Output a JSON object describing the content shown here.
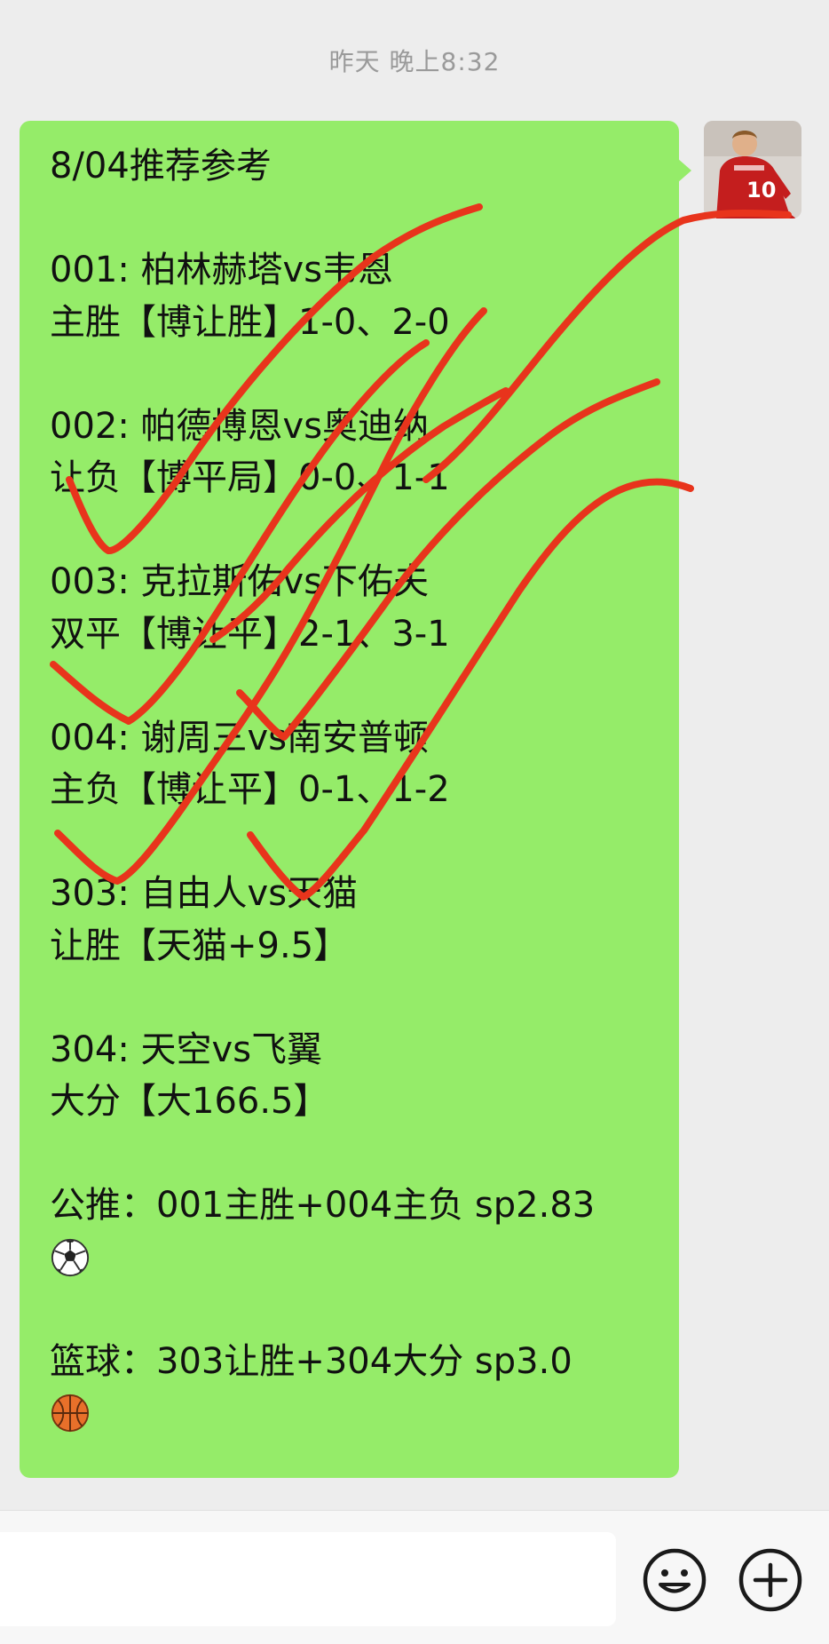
{
  "chat": {
    "timestamp": "昨天 晚上8:32"
  },
  "message": {
    "lines": [
      "8/04推荐参考",
      "",
      "001: 柏林赫塔vs韦恩",
      "主胜【博让胜】1-0、2-0",
      "",
      "002: 帕德博恩vs奥迪纳",
      "让负【博平局】0-0、1-1",
      "",
      "003: 克拉斯佑vs下佑夫",
      "双平【博让平】2-1、3-1",
      "",
      "004: 谢周三vs南安普顿",
      "主负【博让平】0-1、1-2",
      "",
      "303: 自由人vs天猫",
      "让胜【天猫+9.5】",
      "",
      "304: 天空vs飞翼",
      "大分【大166.5】",
      "",
      "公推：001主胜+004主负 sp2.83",
      "",
      "",
      "篮球：303让胜+304大分 sp3.0"
    ],
    "emojis": [
      "soccer-ball-emoji",
      "basketball-emoji"
    ]
  },
  "overlay": {
    "annotation": "red-check-marks",
    "color": "#e8341c"
  },
  "avatar": {
    "jersey_number": "10"
  },
  "input_bar": {
    "placeholder": ""
  },
  "colors": {
    "background": "#ededed",
    "bubble": "#95ec69",
    "check_marks": "#e8341c"
  }
}
